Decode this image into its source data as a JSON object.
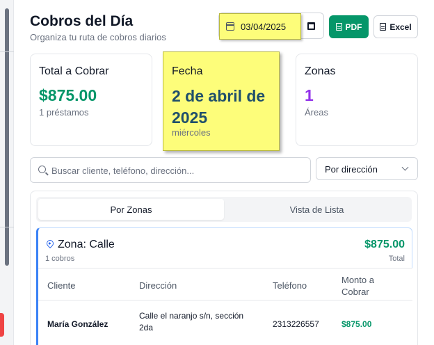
{
  "header": {
    "title": "Cobros del Día",
    "subtitle": "Organiza tu ruta de cobros diarios",
    "date_value": "03/04/2025",
    "pdf_label": "PDF",
    "excel_label": "Excel"
  },
  "cards": [
    {
      "label": "Total a Cobrar",
      "value": "$875.00",
      "sub": "1 préstamos",
      "value_color": "#059669"
    },
    {
      "label": "Fecha",
      "value": "2 de abril de 2025",
      "sub": "miércoles",
      "value_color": "#1f4f6b"
    },
    {
      "label": "Zonas",
      "value": "1",
      "sub": "Áreas",
      "value_color": "#9333ea"
    }
  ],
  "search": {
    "placeholder": "Buscar cliente, teléfono, dirección..."
  },
  "sort_select": {
    "value": "Por dirección"
  },
  "tabs": [
    {
      "label": "Por Zonas",
      "active": true
    },
    {
      "label": "Vista de Lista",
      "active": false
    }
  ],
  "zone": {
    "title": "Zona: Calle",
    "count": "1 cobros",
    "total": "$875.00",
    "total_label": "Total",
    "columns": [
      "Cliente",
      "Dirección",
      "Teléfono",
      "Monto a Cobrar"
    ],
    "rows": [
      {
        "cliente": "María González",
        "direccion": "Calle el naranjo s/n, sección 2da",
        "telefono": "2313226557",
        "monto": "$875.00"
      }
    ]
  },
  "colors": {
    "accent_green": "#059669",
    "highlight_yellow": "#fdfd7a",
    "zone_border": "#3b82f6"
  }
}
